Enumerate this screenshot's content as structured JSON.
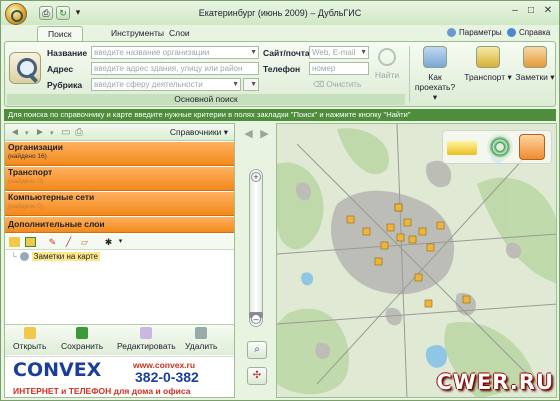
{
  "window": {
    "title": "Екатеринбург (июнь 2009) – ДубльГИС",
    "minimize": "–",
    "maximize": "□",
    "close": "✕"
  },
  "tabs": [
    {
      "label": "Поиск",
      "active": true
    },
    {
      "label": "Инструменты",
      "active": false
    },
    {
      "label": "Слои",
      "active": false
    }
  ],
  "toplinks": {
    "params": "Параметры",
    "help": "Справка"
  },
  "search": {
    "group_label": "Основной поиск",
    "name_label": "Название",
    "name_placeholder": "введите название организации",
    "address_label": "Адрес",
    "address_placeholder": "введите адрес здания, улицу или район",
    "rubric_label": "Рубрика",
    "rubric_placeholder": "введите сферу деятельности",
    "site_label": "Сайт/почта",
    "site_placeholder": "Web, E-mail",
    "phone_label": "Телефон",
    "phone_placeholder": "номер",
    "clear_label": "Очистить",
    "find_label": "Найти"
  },
  "ribbon_buttons": {
    "route": "Как проехать?",
    "transport": "Транспорт",
    "notes": "Заметки"
  },
  "hint": "Для поиска по справочнику и карте введите нужные критерии в полях закладки \"Поиск\" и нажмите кнопку \"Найти\"",
  "left": {
    "directories": "Справочники",
    "sections": [
      {
        "title": "Организации",
        "sub": "(найдено 16)"
      },
      {
        "title": "Транспорт",
        "sub": "(найдено 0)"
      },
      {
        "title": "Компьютерные сети",
        "sub": "(найдено 0)"
      },
      {
        "title": "Дополнительные слои",
        "sub": ""
      }
    ],
    "tree_item": "Заметки на карте",
    "actions": {
      "open": "Открыть",
      "save": "Сохранить",
      "edit": "Редактировать",
      "delete": "Удалить"
    }
  },
  "banner": {
    "brand": "CONVEX",
    "url": "www.convex.ru",
    "phone": "382-0-382",
    "tagline": "ИНТЕРНЕТ и ТЕЛЕФОН для дома и офиса"
  },
  "map": {
    "zoom_plus": "+",
    "zoom_minus": "–",
    "watermark": "CWER.RU"
  },
  "colors": {
    "accent_green": "#4e8d3c",
    "section_orange": "#f38a1a",
    "brand_blue": "#1a3f9a",
    "brand_red": "#d03020"
  }
}
